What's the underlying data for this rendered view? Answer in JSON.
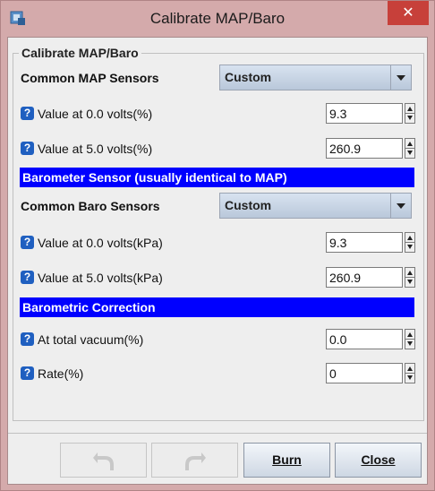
{
  "window": {
    "title": "Calibrate MAP/Baro",
    "close_glyph": "✕"
  },
  "group": {
    "legend": "Calibrate MAP/Baro"
  },
  "map": {
    "sensors_label": "Common MAP Sensors",
    "sensors_value": "Custom",
    "v0_label": "Value at 0.0 volts(%)",
    "v0_value": "9.3",
    "v5_label": "Value at 5.0 volts(%)",
    "v5_value": "260.9"
  },
  "baro_header": "Barometer Sensor (usually identical to MAP)",
  "baro": {
    "sensors_label": "Common Baro Sensors",
    "sensors_value": "Custom",
    "v0_label": "Value at 0.0 volts(kPa)",
    "v0_value": "9.3",
    "v5_label": "Value at 5.0 volts(kPa)",
    "v5_value": "260.9"
  },
  "correction_header": "Barometric Correction",
  "correction": {
    "vacuum_label": "At total vacuum(%)",
    "vacuum_value": "0.0",
    "rate_label": "Rate(%)",
    "rate_value": "0"
  },
  "buttons": {
    "undo_icon": "undo-icon",
    "redo_icon": "redo-icon",
    "burn_label": "Burn",
    "close_label": "Close"
  },
  "help_glyph": "?",
  "colors": {
    "section_band": "#0000ff",
    "help_icon": "#1f5fc0",
    "close_button": "#c7403a"
  }
}
